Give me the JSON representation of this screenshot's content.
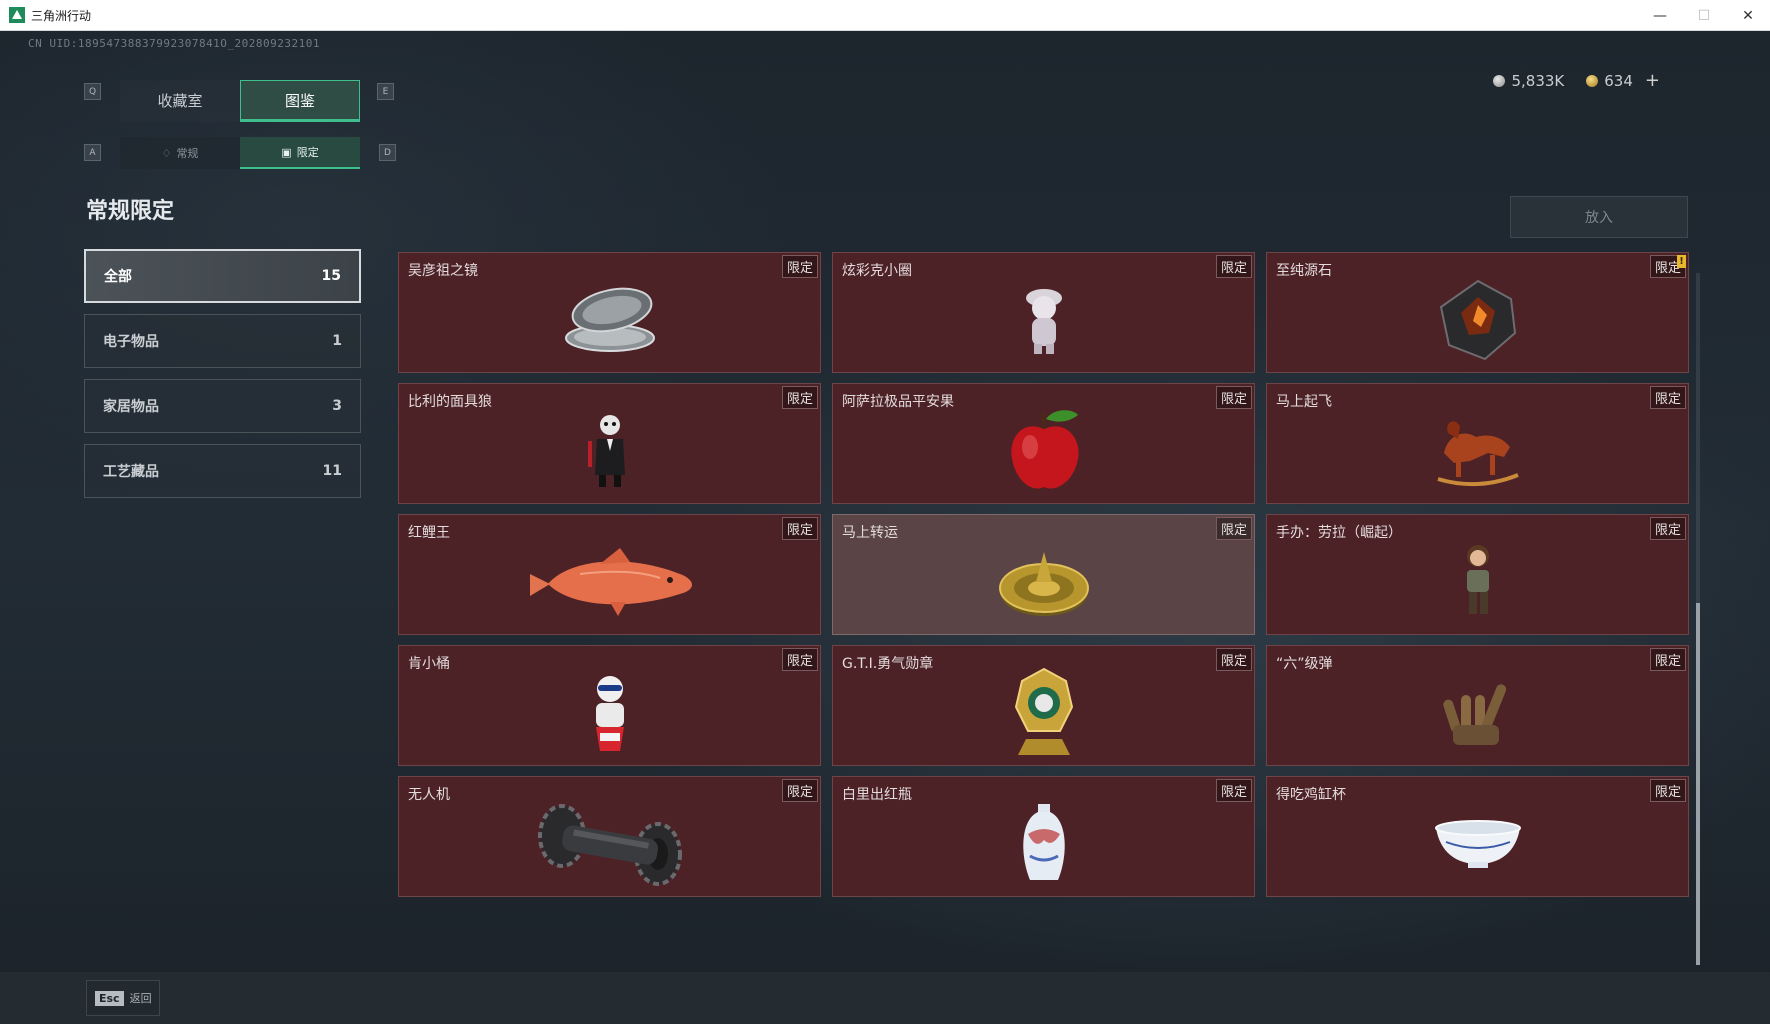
{
  "window": {
    "title": "三角洲行动",
    "controls": [
      "—",
      "☐",
      "✕"
    ]
  },
  "header": {
    "uid": "CN UID:18954738837992307841O_202809232101",
    "silver": "5,833K",
    "gold": "634",
    "plus": "+"
  },
  "tabs": {
    "key_left": "Q",
    "key_right": "E",
    "items": [
      {
        "label": "收藏室"
      },
      {
        "label": "图鉴"
      }
    ],
    "sub_key_left": "A",
    "sub_key_right": "D",
    "sub": [
      {
        "label": "常规"
      },
      {
        "label": "限定"
      }
    ]
  },
  "section_title": "常规限定",
  "put_in_label": "放入",
  "categories": [
    {
      "label": "全部",
      "count": "15"
    },
    {
      "label": "电子物品",
      "count": "1"
    },
    {
      "label": "家居物品",
      "count": "3"
    },
    {
      "label": "工艺藏品",
      "count": "11"
    }
  ],
  "tag_label": "限定",
  "alert_mark": "!",
  "items": [
    {
      "name": "吴彦祖之镜",
      "icon": "compact-mirror-icon"
    },
    {
      "name": "炫彩克小圈",
      "icon": "figurine-icon"
    },
    {
      "name": "至纯源石",
      "icon": "crystal-icon"
    },
    {
      "name": "比利的面具狼",
      "icon": "puppet-icon"
    },
    {
      "name": "阿萨拉极品平安果",
      "icon": "apple-icon"
    },
    {
      "name": "马上起飞",
      "icon": "rocking-horse-icon"
    },
    {
      "name": "红鲤王",
      "icon": "carp-icon"
    },
    {
      "name": "马上转运",
      "icon": "golden-dial-icon"
    },
    {
      "name": "手办：劳拉（崛起）",
      "icon": "figure-icon"
    },
    {
      "name": "肯小桶",
      "icon": "bucket-figure-icon"
    },
    {
      "name": "G.T.I.勇气勋章",
      "icon": "medal-icon"
    },
    {
      "name": "“六”级弹",
      "icon": "hand-grenade-icon"
    },
    {
      "name": "无人机",
      "icon": "drone-icon"
    },
    {
      "name": "白里出红瓶",
      "icon": "vase-icon"
    },
    {
      "name": "得吃鸡缸杯",
      "icon": "bowl-icon"
    }
  ],
  "footer": {
    "esc_key": "Esc",
    "back_label": "返回"
  },
  "colors": {
    "accent": "#3fbf8e",
    "card_bg": "#4d2226",
    "card_hover": "#5a4445"
  }
}
